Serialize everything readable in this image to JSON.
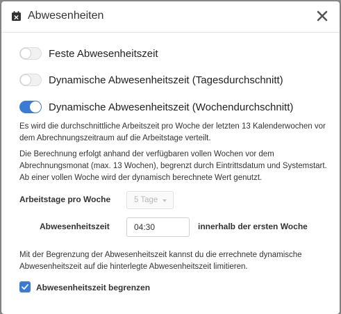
{
  "dialog": {
    "title": "Abwesenheiten",
    "header_icon": "calendar-x-icon",
    "close_icon": "close-icon"
  },
  "options": [
    {
      "label": "Feste Abwesenheitszeit",
      "enabled": false
    },
    {
      "label": "Dynamische Abwesenheitszeit (Tagesdurchschnitt)",
      "enabled": false
    },
    {
      "label": "Dynamische Abwesenheitszeit (Wochendurchschnitt)",
      "enabled": true
    }
  ],
  "info": {
    "paragraph_1": "Es wird die durchschnittliche Arbeitszeit pro Woche der letzten 13 Kalenderwochen vor dem Abrechnungszeitraum auf die Arbeitstage verteilt.",
    "paragraph_2": "Die Berechnung erfolgt anhand der verfügbaren vollen Wochen vor dem Abrechnungsmonat (max. 13 Wochen), begrenzt durch Eintrittsdatum und Systemstart. Ab einer vollen Woche wird der dynamisch berechnete Wert genutzt."
  },
  "form": {
    "workdays_label": "Arbeitstage pro Woche",
    "workdays_value": "5 Tage",
    "absence_label": "Abwesenheitszeit",
    "absence_value": "04:30",
    "absence_suffix": "innerhalb der ersten Woche"
  },
  "limit": {
    "description": "Mit der Begrenzung der Abwesenheitszeit kannst du die errechnete dynamische Abwesenheitszeit auf die hinterlegte Abwesenheitszeit limitieren.",
    "checkbox_label": "Abwesenheitszeit begrenzen",
    "checked": true
  },
  "colors": {
    "accent": "#3a7bd5",
    "text": "#222222"
  }
}
